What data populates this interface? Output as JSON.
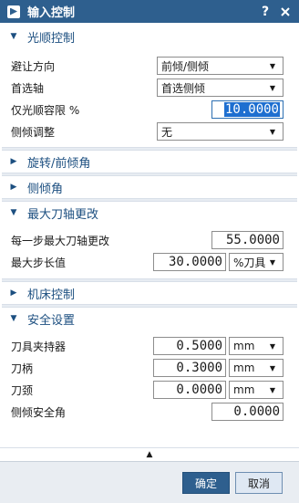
{
  "titlebar": {
    "title": "输入控制",
    "help": "?",
    "close": "X"
  },
  "sections": {
    "smooth_control": {
      "label": "光顺控制",
      "avoid_direction_label": "避让方向",
      "avoid_direction_value": "前倾/侧倾",
      "priority_axis_label": "首选轴",
      "priority_axis_value": "首选侧倾",
      "tolerance_label": "仅光顺容限 %",
      "tolerance_value": "10.0000",
      "tilt_adjust_label": "侧倾调整",
      "tilt_adjust_value": "无"
    },
    "rotate_lead": {
      "label": "旋转/前倾角"
    },
    "tilt_angle": {
      "label": "侧倾角"
    },
    "max_axis_change": {
      "label": "最大刀轴更改",
      "per_step_label": "每一步最大刀轴更改",
      "per_step_value": "55.0000",
      "max_step_label": "最大步长值",
      "max_step_value": "30.0000",
      "max_step_unit": "%刀具"
    },
    "machine_control": {
      "label": "机床控制"
    },
    "safety": {
      "label": "安全设置",
      "holder_label": "刀具夹持器",
      "holder_value": "0.5000",
      "holder_unit": "mm",
      "shank_label": "刀柄",
      "shank_value": "0.3000",
      "shank_unit": "mm",
      "neck_label": "刀颈",
      "neck_value": "0.0000",
      "neck_unit": "mm",
      "tilt_safety_label": "侧倾安全角",
      "tilt_safety_value": "0.0000"
    }
  },
  "buttons": {
    "ok": "确定",
    "cancel": "取消"
  }
}
